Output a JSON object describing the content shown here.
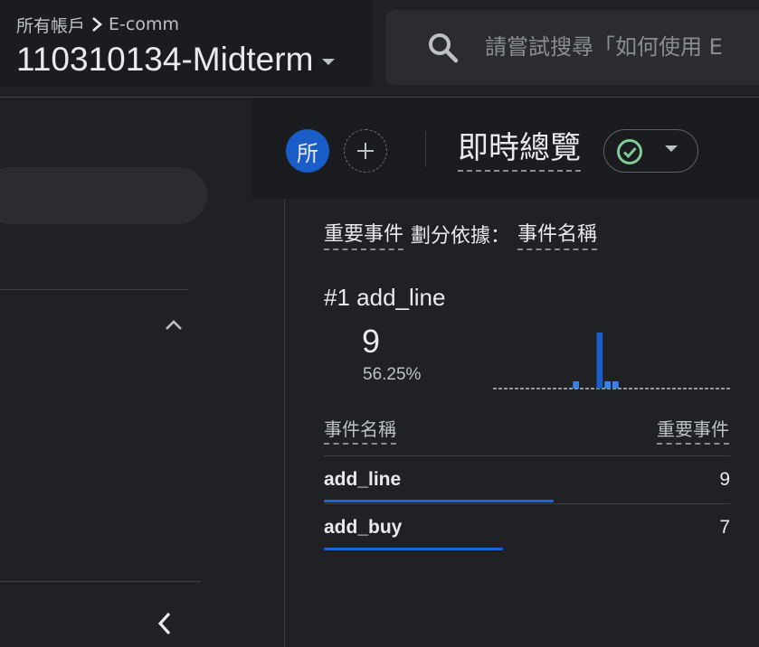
{
  "header": {
    "breadcrumb_root": "所有帳戶",
    "breadcrumb_current": "E-comm",
    "property_name": "110310134-Midterm",
    "search_placeholder": "請嘗試搜尋「如何使用 E"
  },
  "toolbar": {
    "avatar_letter": "所",
    "report_title": "即時總覽"
  },
  "card": {
    "metric_label": "重要事件",
    "dimension_prefix": "劃分依據：",
    "dimension_label": "事件名稱",
    "top_rank": "#1",
    "top_name": "add_line",
    "top_value": "9",
    "top_percent": "56.25%",
    "spark_values": [
      0,
      0,
      0,
      0,
      0,
      0,
      0,
      0,
      0,
      0,
      1,
      0,
      0,
      9,
      1,
      1,
      0,
      0,
      0,
      0,
      0,
      0,
      0,
      0,
      0,
      0,
      0,
      0,
      0,
      0
    ],
    "col_dimension": "事件名稱",
    "col_metric": "重要事件",
    "rows": [
      {
        "name": "add_line",
        "value": "9",
        "share": 0.5625
      },
      {
        "name": "add_buy",
        "value": "7",
        "share": 0.4375
      }
    ]
  },
  "colors": {
    "accent": "#1a66d2",
    "spark_bar": "#3b82e6",
    "spark_bar_highlight": "#1a5cc8",
    "status_ok": "#81c995"
  }
}
